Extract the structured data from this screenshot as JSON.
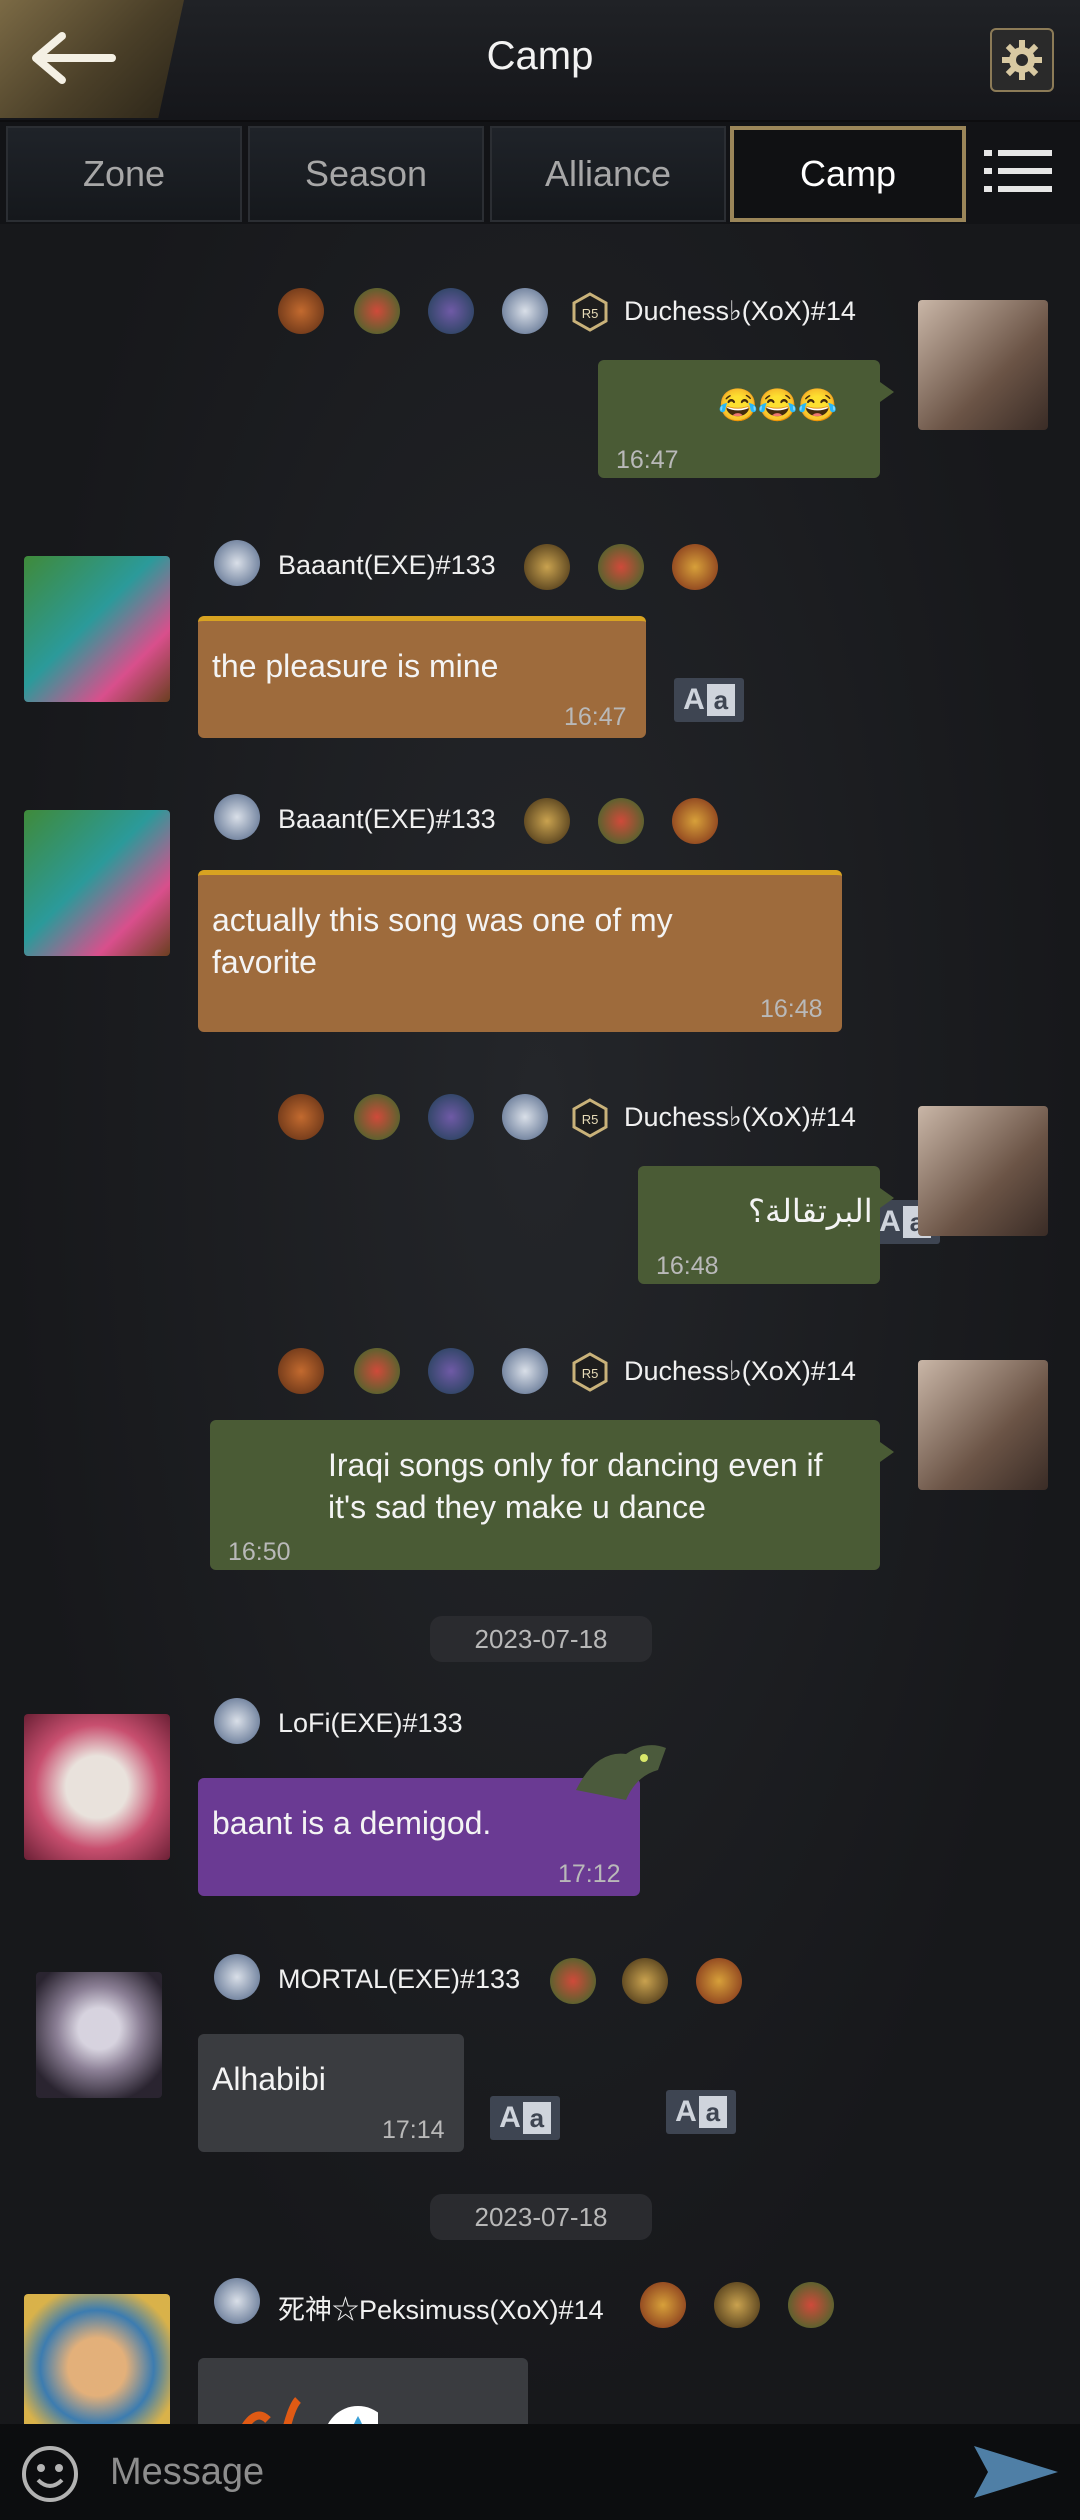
{
  "header": {
    "title": "Camp"
  },
  "tabs": [
    {
      "label": "Zone"
    },
    {
      "label": "Season"
    },
    {
      "label": "Alliance"
    },
    {
      "label": "Camp",
      "active": true
    }
  ],
  "messages": [
    {
      "sender": "Duchess♭(XoX)#14",
      "rank": "R5",
      "text": "😂😂😂",
      "time": "16:47",
      "side": "right",
      "style": "green"
    },
    {
      "sender": "Baaant(EXE)#133",
      "text": "the pleasure is mine",
      "time": "16:47",
      "side": "left",
      "style": "orange"
    },
    {
      "sender": "Baaant(EXE)#133",
      "text": "actually this song was one of my favorite",
      "time": "16:48",
      "side": "left",
      "style": "orange"
    },
    {
      "sender": "Duchess♭(XoX)#14",
      "rank": "R5",
      "text": "البرتقالة؟",
      "time": "16:48",
      "side": "right",
      "style": "green"
    },
    {
      "sender": "Duchess♭(XoX)#14",
      "rank": "R5",
      "text": "Iraqi songs only for dancing even if it's sad they make u dance",
      "time": "16:50",
      "side": "right",
      "style": "green"
    },
    {
      "sender": "LoFi(EXE)#133",
      "text": "baant is a demigod.",
      "time": "17:12",
      "side": "left",
      "style": "purple"
    },
    {
      "sender": "MORTAL(EXE)#133",
      "text": "Alhabibi",
      "time": "17:14",
      "side": "left",
      "style": "gray"
    },
    {
      "sender": "死神☆Peksimuss(XoX)#14",
      "text": "",
      "time": "",
      "side": "left",
      "style": "gray"
    }
  ],
  "dates": [
    "2023-07-18",
    "2023-07-18"
  ],
  "translate": {
    "big": "A",
    "small": "a"
  },
  "input": {
    "placeholder": "Message"
  },
  "colors": {
    "green_bubble": "#4a5b35",
    "orange_bubble": "#9e6b3c",
    "purple_bubble": "#6a3a93",
    "gray_bubble": "#3a3c40",
    "gold_accent": "#9b8659"
  }
}
